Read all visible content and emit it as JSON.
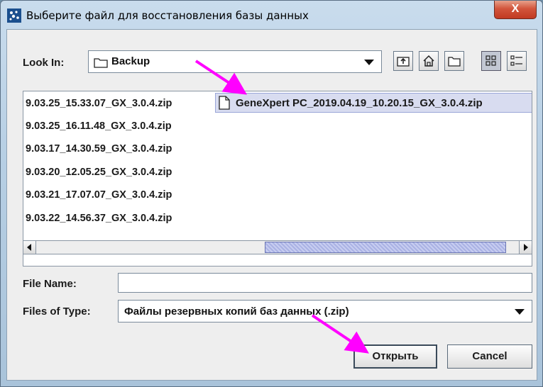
{
  "window": {
    "title": "Выберите файл для восстановления базы данных",
    "close_label": "X"
  },
  "look_in": {
    "label": "Look In:",
    "value": "Backup"
  },
  "toolbar": {
    "icons": [
      "up-one-level-icon",
      "home-icon",
      "new-folder-icon",
      "list-view-icon",
      "details-view-icon"
    ]
  },
  "files": {
    "left_column": [
      "9.03.25_15.33.07_GX_3.0.4.zip",
      "9.03.25_16.11.48_GX_3.0.4.zip",
      "9.03.17_14.30.59_GX_3.0.4.zip",
      "9.03.20_12.05.25_GX_3.0.4.zip",
      "9.03.21_17.07.07_GX_3.0.4.zip",
      "9.03.22_14.56.37_GX_3.0.4.zip"
    ],
    "selected": "GeneXpert PC_2019.04.19_10.20.15_GX_3.0.4.zip"
  },
  "file_name": {
    "label": "File Name:",
    "value": ""
  },
  "files_of_type": {
    "label": "Files of Type:",
    "value": "Файлы резервных копий баз данных (.zip)"
  },
  "buttons": {
    "open": "Открыть",
    "cancel": "Cancel"
  },
  "colors": {
    "selection": "#d8dcf0",
    "annotation_arrow": "#ff00ff",
    "close_button": "#c13a22"
  }
}
